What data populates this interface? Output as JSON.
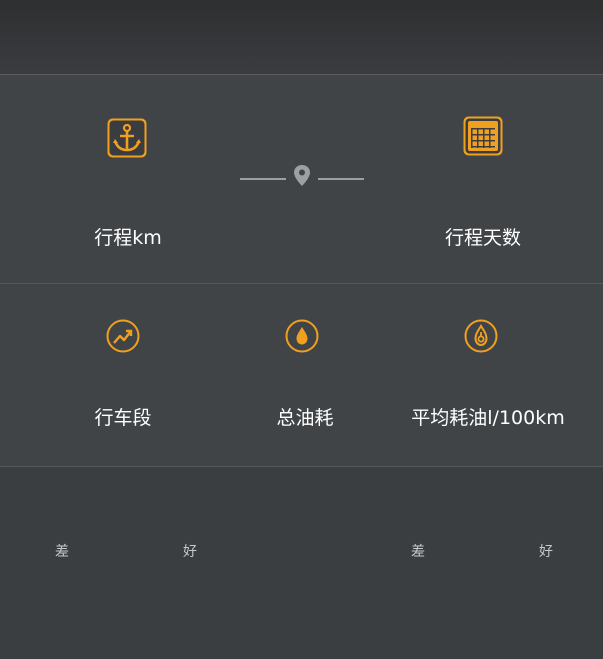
{
  "stats": {
    "mileage_label": "行程km",
    "days_label": "行程天数",
    "segments_label": "行车段",
    "total_fuel_label": "总油耗",
    "avg_fuel_label": "平均耗油l/100km"
  },
  "ratings": [
    {
      "low": "差",
      "high": "好"
    },
    {
      "low": "差",
      "high": "好"
    }
  ],
  "icons": {
    "mileage": "anchor-icon",
    "days": "calendar-icon",
    "route": "location-pin-icon",
    "segments": "trend-icon",
    "total_fuel": "fuel-drop-icon",
    "avg_fuel": "fuel-gauge-icon"
  },
  "colors": {
    "accent": "#f0a020",
    "background": "#414447",
    "text": "#ffffff",
    "muted": "#9aa0a5"
  }
}
